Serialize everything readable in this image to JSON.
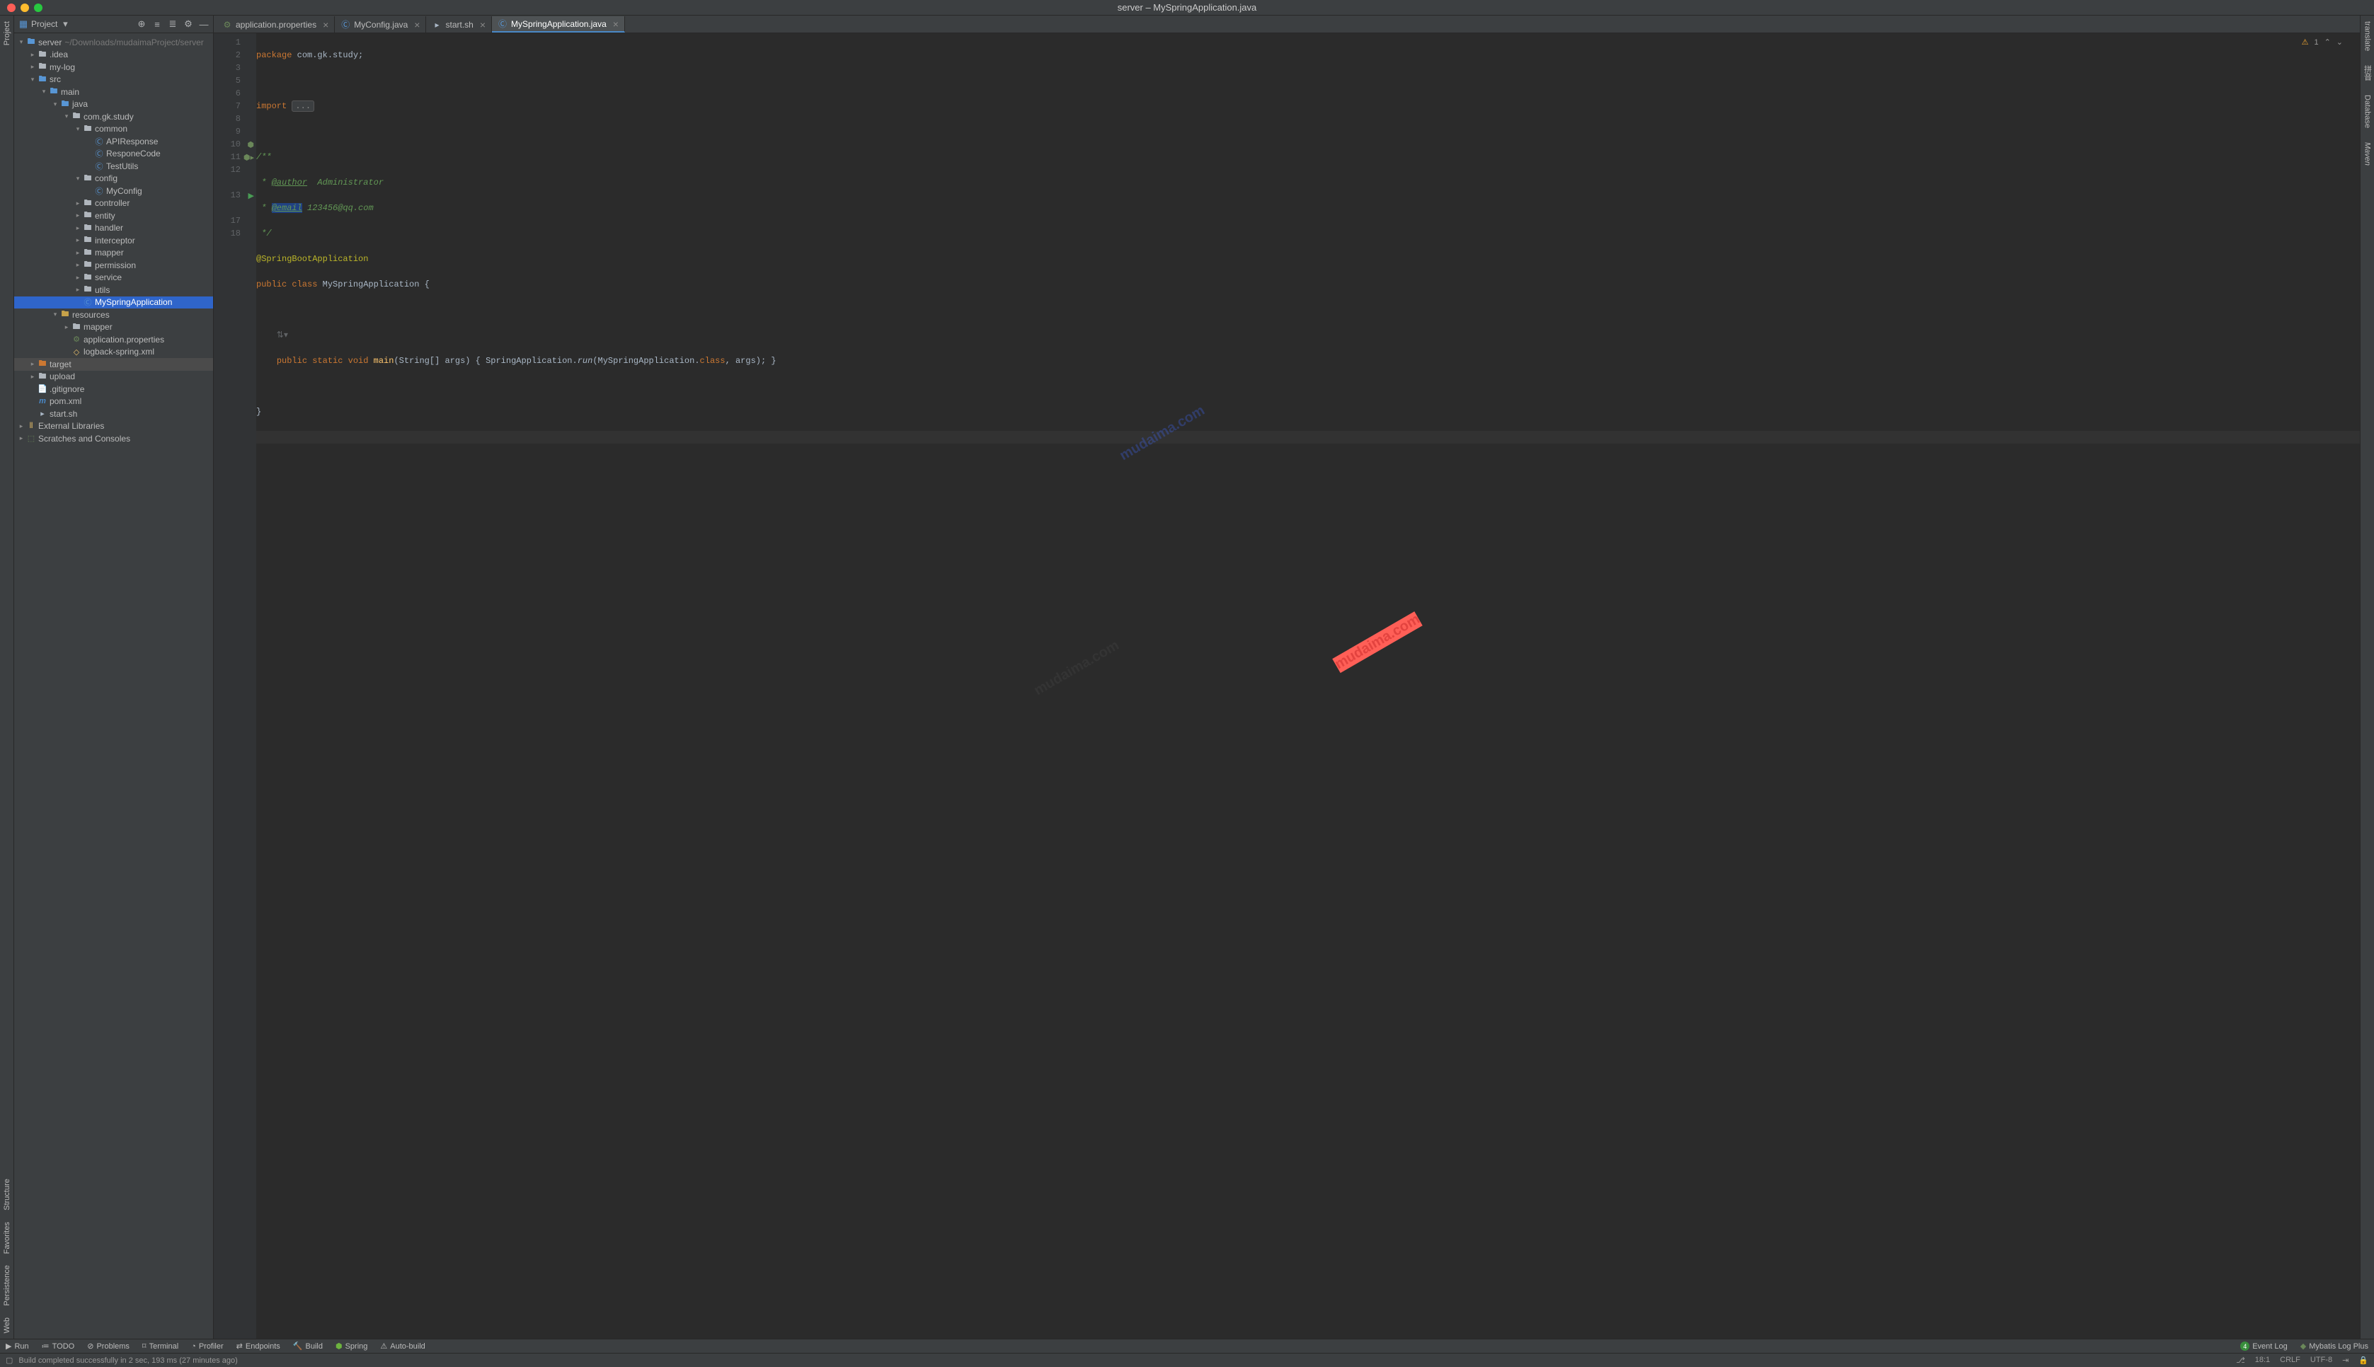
{
  "window": {
    "title": "server – MySpringApplication.java"
  },
  "sidebar": {
    "label": "Project",
    "project_name": "server",
    "project_path": "~/Downloads/mudaimaProject/server"
  },
  "tree": [
    {
      "depth": 0,
      "arrow": "v",
      "icon": "folder-src",
      "label": "server",
      "extra": "~/Downloads/mudaimaProject/server"
    },
    {
      "depth": 1,
      "arrow": ">",
      "icon": "folder",
      "label": ".idea"
    },
    {
      "depth": 1,
      "arrow": ">",
      "icon": "folder",
      "label": "my-log"
    },
    {
      "depth": 1,
      "arrow": "v",
      "icon": "folder-src",
      "label": "src"
    },
    {
      "depth": 2,
      "arrow": "v",
      "icon": "folder-src",
      "label": "main"
    },
    {
      "depth": 3,
      "arrow": "v",
      "icon": "folder-src",
      "label": "java"
    },
    {
      "depth": 4,
      "arrow": "v",
      "icon": "folder-pkg",
      "label": "com.gk.study"
    },
    {
      "depth": 5,
      "arrow": "v",
      "icon": "folder-pkg",
      "label": "common"
    },
    {
      "depth": 6,
      "arrow": "",
      "icon": "class",
      "label": "APIResponse"
    },
    {
      "depth": 6,
      "arrow": "",
      "icon": "class",
      "label": "ResponeCode"
    },
    {
      "depth": 6,
      "arrow": "",
      "icon": "class",
      "label": "TestUtils"
    },
    {
      "depth": 5,
      "arrow": "v",
      "icon": "folder-pkg",
      "label": "config"
    },
    {
      "depth": 6,
      "arrow": "",
      "icon": "class",
      "label": "MyConfig"
    },
    {
      "depth": 5,
      "arrow": ">",
      "icon": "folder-pkg",
      "label": "controller"
    },
    {
      "depth": 5,
      "arrow": ">",
      "icon": "folder-pkg",
      "label": "entity"
    },
    {
      "depth": 5,
      "arrow": ">",
      "icon": "folder-pkg",
      "label": "handler"
    },
    {
      "depth": 5,
      "arrow": ">",
      "icon": "folder-pkg",
      "label": "interceptor"
    },
    {
      "depth": 5,
      "arrow": ">",
      "icon": "folder-pkg",
      "label": "mapper"
    },
    {
      "depth": 5,
      "arrow": ">",
      "icon": "folder-pkg",
      "label": "permission"
    },
    {
      "depth": 5,
      "arrow": ">",
      "icon": "folder-pkg",
      "label": "service"
    },
    {
      "depth": 5,
      "arrow": ">",
      "icon": "folder-pkg",
      "label": "utils"
    },
    {
      "depth": 5,
      "arrow": "",
      "icon": "java",
      "label": "MySpringApplication",
      "selected": true
    },
    {
      "depth": 3,
      "arrow": "v",
      "icon": "folder-res",
      "label": "resources"
    },
    {
      "depth": 4,
      "arrow": ">",
      "icon": "folder",
      "label": "mapper"
    },
    {
      "depth": 4,
      "arrow": "",
      "icon": "props",
      "label": "application.properties"
    },
    {
      "depth": 4,
      "arrow": "",
      "icon": "xml",
      "label": "logback-spring.xml"
    },
    {
      "depth": 1,
      "arrow": ">",
      "icon": "folder-tgt",
      "label": "target",
      "seldim": true
    },
    {
      "depth": 1,
      "arrow": ">",
      "icon": "folder",
      "label": "upload"
    },
    {
      "depth": 1,
      "arrow": "",
      "icon": "file",
      "label": ".gitignore"
    },
    {
      "depth": 1,
      "arrow": "",
      "icon": "pom",
      "label": "pom.xml"
    },
    {
      "depth": 1,
      "arrow": "",
      "icon": "sh",
      "label": "start.sh"
    },
    {
      "depth": 0,
      "arrow": ">",
      "icon": "lib",
      "label": "External Libraries"
    },
    {
      "depth": 0,
      "arrow": ">",
      "icon": "scratch",
      "label": "Scratches and Consoles"
    }
  ],
  "tabs": [
    {
      "label": "application.properties",
      "icon": "props"
    },
    {
      "label": "MyConfig.java",
      "icon": "java"
    },
    {
      "label": "start.sh",
      "icon": "sh"
    },
    {
      "label": "MySpringApplication.java",
      "icon": "java",
      "active": true
    }
  ],
  "code_lines": [
    "1",
    "2",
    "3",
    "5",
    "6",
    "7",
    "8",
    "9",
    "10",
    "11",
    "12",
    "",
    "13",
    "",
    "17",
    "18"
  ],
  "code": {
    "l1_kw": "package",
    "l1_pkg": " com.gk.study;",
    "l3_kw": "import ",
    "l3_fold": "...",
    "l6": "/**",
    "l7_pre": " * ",
    "l7_tag": "@author",
    "l7_txt": "  Administrator",
    "l8_pre": " * ",
    "l8_tag": "@email",
    "l8_txt": " 123456@qq.com",
    "l9": " */",
    "l10": "@SpringBootApplication",
    "l11_kw": "public class ",
    "l11_cls": "MySpringApplication ",
    "l11_b": "{",
    "l13_pre": "    ",
    "l13_kw": "public static void ",
    "l13_fn": "main",
    "l13_sig": "(String[] args) ",
    "l13_b1": "{ ",
    "l13_call": "SpringApplication.",
    "l13_run": "run",
    "l13_args": "(MySpringApplication.",
    "l13_class": "class",
    "l13_end": ", args); ",
    "l13_b2": "}",
    "l17": "}"
  },
  "editor_status": {
    "warnings": "1"
  },
  "left_chips": {
    "project": "Project",
    "structure": "Structure",
    "favorites": "Favorites",
    "persistence": "Persistence",
    "web": "Web"
  },
  "right_chips": {
    "translate": "translate",
    "pinyin": "拼音",
    "database": "Database",
    "maven": "Maven"
  },
  "bottom_tools": {
    "run": "Run",
    "todo": "TODO",
    "problems": "Problems",
    "terminal": "Terminal",
    "profiler": "Profiler",
    "endpoints": "Endpoints",
    "build": "Build",
    "spring": "Spring",
    "autobuild": "Auto-build",
    "eventlog": "Event Log",
    "eventlog_badge": "4",
    "mybatis": "Mybatis Log Plus"
  },
  "status": {
    "msg": "Build completed successfully in 2 sec, 193 ms (27 minutes ago)",
    "pos": "18:1",
    "linesep": "CRLF",
    "encoding": "UTF-8"
  }
}
